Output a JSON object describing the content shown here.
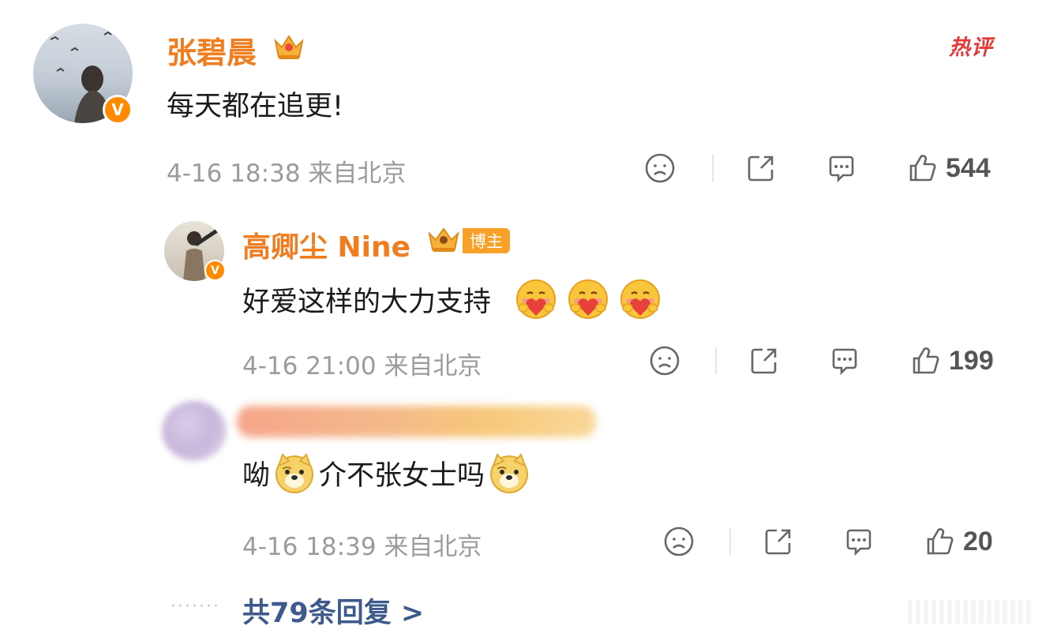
{
  "hot_label": "热评",
  "comment": {
    "author": "张碧晨",
    "text": "每天都在追更!",
    "date": "4-16 18:38",
    "location": "来自北京",
    "likes": "544"
  },
  "replies": [
    {
      "author": "高卿尘 Nine",
      "badge": "博主",
      "text": "好爱这样的大力支持",
      "emoji": "hug-heart-emoji",
      "date": "4-16 21:00",
      "location": "来自北京",
      "likes": "199"
    },
    {
      "author": "",
      "text_part1": "呦",
      "text_part2": "介不张女士吗",
      "emoji": "doge-emoji",
      "date": "4-16 18:39",
      "location": "来自北京",
      "likes": "20"
    }
  ],
  "more_replies": "共79条回复 >",
  "colors": {
    "name": "#f07d1f",
    "badge": "#f7a128",
    "hot": "#e63a3a",
    "link": "#3e5a8c",
    "meta": "#9b9b9b"
  }
}
